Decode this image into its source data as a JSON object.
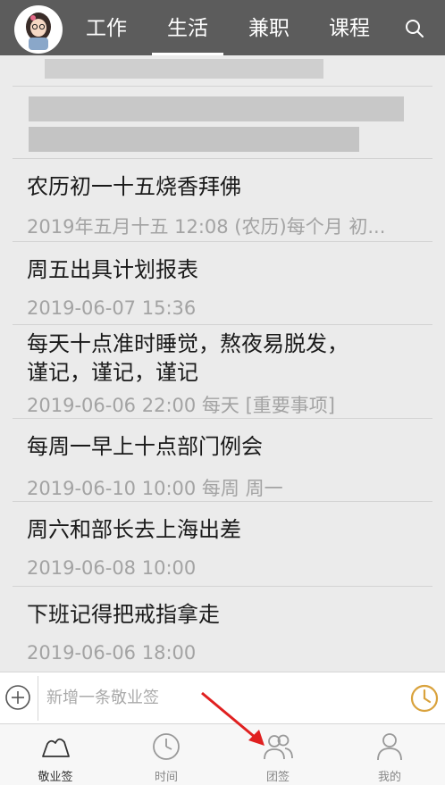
{
  "header": {
    "tabs": [
      {
        "label": "工作"
      },
      {
        "label": "生活"
      },
      {
        "label": "兼职"
      },
      {
        "label": "课程"
      }
    ],
    "active_tab": "生活"
  },
  "items": [
    {
      "title": "农历初一十五烧香拜佛",
      "sub": "2019年五月十五 12:08 (农历)每个月 初..."
    },
    {
      "title": "周五出具计划报表",
      "sub": "2019-06-07 15:36"
    },
    {
      "title_line1": "每天十点准时睡觉，熬夜易脱发，",
      "title_line2": "谨记，谨记，谨记",
      "sub": "2019-06-06 22:00 每天 [重要事项]"
    },
    {
      "title": "每周一早上十点部门例会",
      "sub": "2019-06-10 10:00 每周 周一"
    },
    {
      "title": "周六和部长去上海出差",
      "sub": "2019-06-08 10:00"
    },
    {
      "title": "下班记得把戒指拿走",
      "sub": "2019-06-06 18:00"
    }
  ],
  "input": {
    "placeholder": "新增一条敬业签"
  },
  "bottom_nav": [
    {
      "label": "敬业签"
    },
    {
      "label": "时间"
    },
    {
      "label": "团签"
    },
    {
      "label": "我的"
    }
  ],
  "colors": {
    "header_bg": "#5c5c5c",
    "list_bg": "#ebebeb",
    "clock_accent": "#d9a23c",
    "arrow": "#e02020"
  }
}
